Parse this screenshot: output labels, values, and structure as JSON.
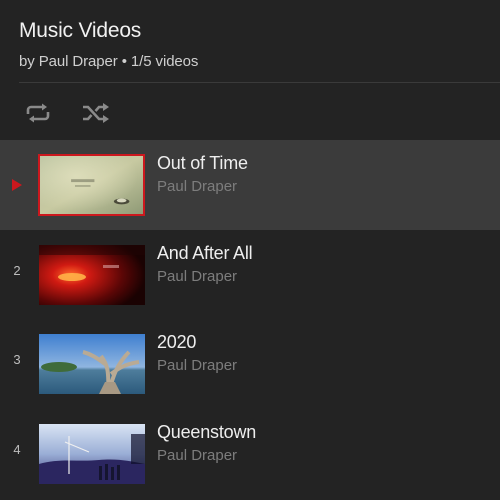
{
  "playlist": {
    "title": "Music Videos",
    "subtitle": "by Paul Draper • 1/5 videos"
  },
  "controls": {
    "loop_icon": "loop-icon",
    "shuffle_icon": "shuffle-icon"
  },
  "videos": [
    {
      "index": "",
      "title": "Out of Time",
      "author": "Paul Draper",
      "active": true
    },
    {
      "index": "2",
      "title": "And After All",
      "author": "Paul Draper",
      "active": false
    },
    {
      "index": "3",
      "title": "2020",
      "author": "Paul Draper",
      "active": false
    },
    {
      "index": "4",
      "title": "Queenstown",
      "author": "Paul Draper",
      "active": false
    }
  ],
  "colors": {
    "background": "#232323",
    "active_row": "#3b3b3b",
    "accent_red": "#cc181e"
  }
}
